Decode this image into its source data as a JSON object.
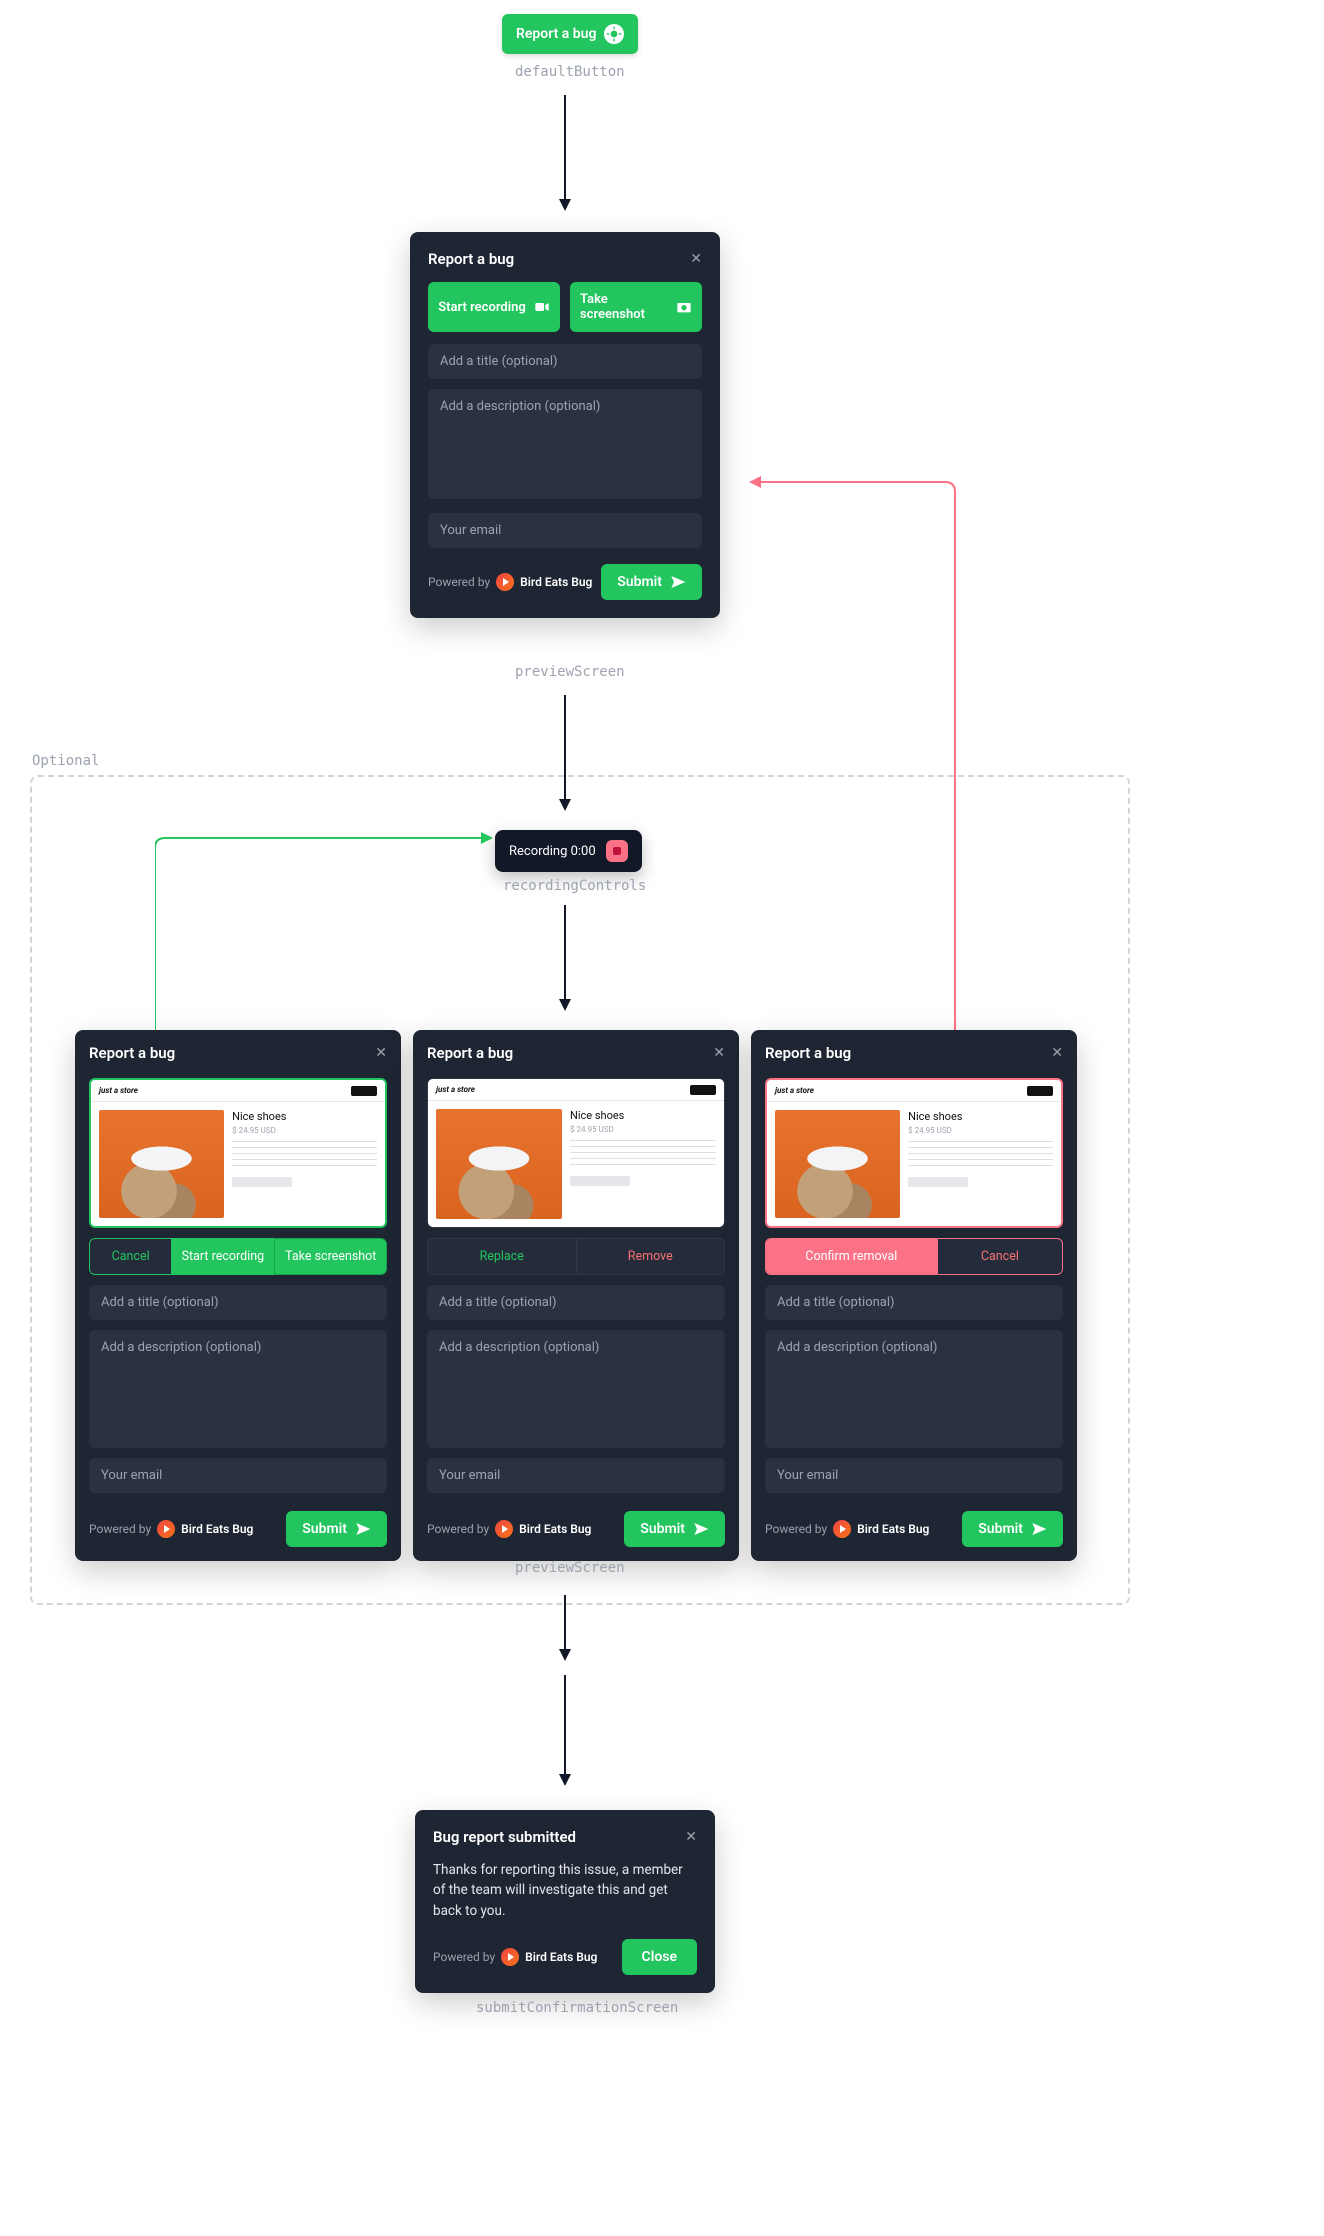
{
  "defaultButton": {
    "label": "Report a bug",
    "caption": "defaultButton"
  },
  "preview1": {
    "title": "Report a bug",
    "startRecording": "Start recording",
    "takeScreenshot": "Take screenshot",
    "titlePlaceholder": "Add a title (optional)",
    "descriptionPlaceholder": "Add a description (optional)",
    "emailPlaceholder": "Your email",
    "poweredBy": "Powered by",
    "brand": "Bird Eats Bug",
    "submit": "Submit",
    "caption": "previewScreen"
  },
  "optional": {
    "label": "Optional"
  },
  "recording": {
    "label": "Recording 0:00",
    "caption": "recordingControls"
  },
  "store": {
    "brand": "just a store",
    "product": "Nice shoes",
    "price": "$ 24.95 USD"
  },
  "threePanels": {
    "title": "Report a bug",
    "titlePlaceholder": "Add a title (optional)",
    "descriptionPlaceholder": "Add a description (optional)",
    "emailPlaceholder": "Your email",
    "poweredBy": "Powered by",
    "brand": "Bird Eats Bug",
    "submit": "Submit",
    "caption": "previewScreen",
    "p1": {
      "cancel": "Cancel",
      "start": "Start recording",
      "screenshot": "Take screenshot"
    },
    "p2": {
      "replace": "Replace",
      "remove": "Remove"
    },
    "p3": {
      "confirm": "Confirm removal",
      "cancel": "Cancel"
    }
  },
  "confirmation": {
    "title": "Bug report submitted",
    "body": "Thanks for reporting this issue, a member of the team will investigate this and get back to you.",
    "poweredBy": "Powered by",
    "brand": "Bird Eats Bug",
    "close": "Close",
    "caption": "submitConfirmationScreen"
  }
}
